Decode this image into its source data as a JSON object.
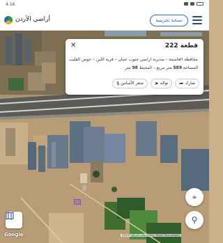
{
  "status_bar": {
    "time": "4:16"
  },
  "app": {
    "name": "أراضي الأردن",
    "trial_button": "نسخة تجريبية"
  },
  "parcel": {
    "title": "قطعة 222",
    "location": "محافظة العاصمة – مديرية اراضي جنوب عمان – قرية اللبن – حوض القليب",
    "area_label": "المساحة",
    "area_value": "589",
    "area_unit": "متر مربع",
    "perimeter_label": "المحيط",
    "perimeter_value": "98",
    "perimeter_unit": "متر",
    "actions": {
      "share": "شارك",
      "directions": "توجّه",
      "base_price": "سعر الأساس"
    }
  },
  "map": {
    "google_logo": "Google",
    "attribution": "بيانات الخرائط ©2025 Airbus, Maxar Technologies"
  },
  "icons": {
    "close": "close-icon",
    "menu": "hamburger-menu-icon",
    "share": "share-icon",
    "directions": "navigation-icon",
    "price": "dollar-icon",
    "locate": "crosshair-icon",
    "search": "search-icon",
    "layers": "map-layers-icon"
  },
  "colors": {
    "accent": "#2a66c7",
    "brand_dark": "#1e4b8f",
    "parcel_outline": "#8a4bd6"
  }
}
